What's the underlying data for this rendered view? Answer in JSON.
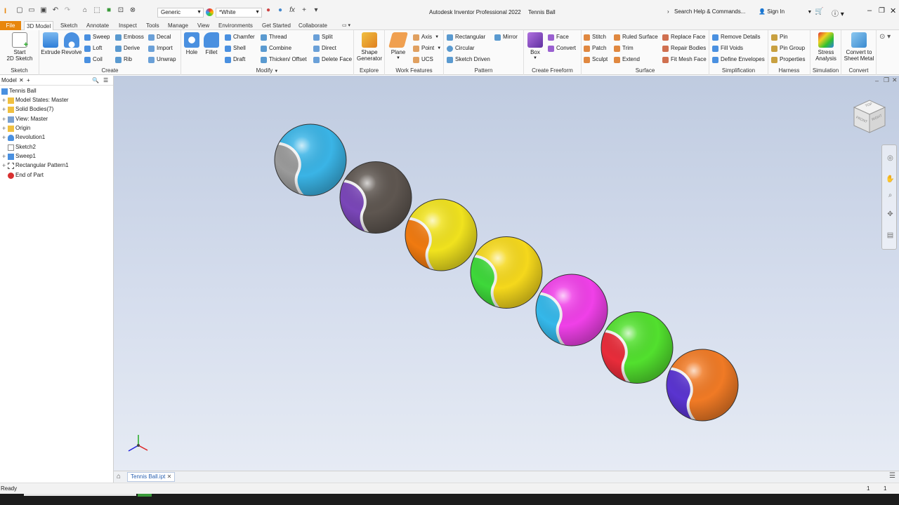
{
  "app": {
    "title": "Autodesk Inventor Professional 2022",
    "document": "Tennis Ball",
    "search_placeholder": "Search Help & Commands...",
    "sign_in": "Sign In",
    "material": "Generic",
    "appearance": "*White"
  },
  "ribbon_tabs": [
    "File",
    "3D Model",
    "Sketch",
    "Annotate",
    "Inspect",
    "Tools",
    "Manage",
    "View",
    "Environments",
    "Get Started",
    "Collaborate"
  ],
  "active_tab": "3D Model",
  "panels": {
    "sketch": {
      "label": "Sketch",
      "start": "Start",
      "start2": "2D Sketch"
    },
    "create": {
      "label": "Create",
      "extrude": "Extrude",
      "revolve": "Revolve",
      "sweep": "Sweep",
      "loft": "Loft",
      "coil": "Coil",
      "emboss": "Emboss",
      "derive": "Derive",
      "rib": "Rib",
      "decal": "Decal",
      "import": "Import",
      "unwrap": "Unwrap"
    },
    "modify": {
      "label": "Modify",
      "hole": "Hole",
      "fillet": "Fillet",
      "chamfer": "Chamfer",
      "shell": "Shell",
      "draft": "Draft",
      "thread": "Thread",
      "combine": "Combine",
      "thicken": "Thicken/ Offset",
      "split": "Split",
      "direct": "Direct",
      "delete_face": "Delete Face"
    },
    "explore": {
      "label": "Explore",
      "shape1": "Shape",
      "shape2": "Generator"
    },
    "work": {
      "label": "Work Features",
      "plane": "Plane",
      "axis": "Axis",
      "point": "Point",
      "ucs": "UCS"
    },
    "pattern": {
      "label": "Pattern",
      "rectangular": "Rectangular",
      "circular": "Circular",
      "sketch_driven": "Sketch Driven",
      "mirror": "Mirror"
    },
    "freeform": {
      "label": "Create Freeform",
      "box": "Box",
      "face": "Face",
      "convert": "Convert"
    },
    "surface": {
      "label": "Surface",
      "stitch": "Stitch",
      "patch": "Patch",
      "sculpt": "Sculpt",
      "ruled": "Ruled Surface",
      "trim": "Trim",
      "extend": "Extend",
      "replace": "Replace Face",
      "repair": "Repair Bodies",
      "fitmesh": "Fit Mesh Face"
    },
    "simplification": {
      "label": "Simplification",
      "remove": "Remove Details",
      "fill": "Fill Voids",
      "define": "Define Envelopes"
    },
    "harness": {
      "label": "Harness",
      "pin": "Pin",
      "pin_group": "Pin Group",
      "properties": "Properties"
    },
    "simulation": {
      "label": "Simulation",
      "stress1": "Stress",
      "stress2": "Analysis"
    },
    "convert": {
      "label": "Convert",
      "c1": "Convert to",
      "c2": "Sheet Metal"
    }
  },
  "browser": {
    "title": "Model",
    "nodes": [
      {
        "label": "Tennis Ball",
        "expand": ""
      },
      {
        "label": "Model States: Master",
        "expand": "+"
      },
      {
        "label": "Solid Bodies(7)",
        "expand": "+"
      },
      {
        "label": "View: Master",
        "expand": "+"
      },
      {
        "label": "Origin",
        "expand": "+"
      },
      {
        "label": "Revolution1",
        "expand": "+"
      },
      {
        "label": "Sketch2",
        "expand": ""
      },
      {
        "label": "Sweep1",
        "expand": "+"
      },
      {
        "label": "Rectangular Pattern1",
        "expand": "+"
      },
      {
        "label": "End of Part",
        "expand": ""
      }
    ]
  },
  "balls": [
    {
      "main": "#3ab4e6",
      "side": "#9a9a9a"
    },
    {
      "main": "#5e5650",
      "side": "#7a46b8"
    },
    {
      "main": "#f0e21e",
      "side": "#f07a10"
    },
    {
      "main": "#f5d81c",
      "side": "#3ed83a"
    },
    {
      "main": "#f040e8",
      "side": "#35b8ea"
    },
    {
      "main": "#52e02e",
      "side": "#e82c3a"
    },
    {
      "main": "#f07a25",
      "side": "#5a34d0"
    }
  ],
  "viewcube": {
    "front": "FRONT",
    "right": "RIGHT",
    "top": "TOP"
  },
  "doc_tab": "Tennis Ball.ipt",
  "status": {
    "text": "Ready",
    "n1": "1",
    "n2": "1"
  }
}
